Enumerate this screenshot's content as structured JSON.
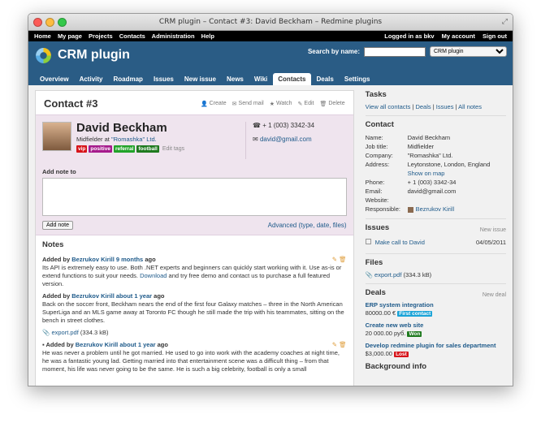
{
  "window": {
    "title": "CRM plugin – Contact #3: David Beckham – Redmine plugins"
  },
  "topmenu": {
    "left": [
      "Home",
      "My page",
      "Projects",
      "Contacts",
      "Administration",
      "Help"
    ],
    "logged_in": "Logged in as bkv",
    "my_account": "My account",
    "sign_out": "Sign out"
  },
  "header": {
    "brand": "CRM plugin",
    "search_label": "Search by name:",
    "project_select": "CRM plugin",
    "tabs": [
      "Overview",
      "Activity",
      "Roadmap",
      "Issues",
      "New issue",
      "News",
      "Wiki",
      "Contacts",
      "Deals",
      "Settings"
    ],
    "active_tab": "Contacts"
  },
  "contact": {
    "title": "Contact #3",
    "actions": [
      "Create",
      "Send mail",
      "Watch",
      "Edit",
      "Delete"
    ],
    "name": "David Beckham",
    "job_prefix": "Midfielder at",
    "company": "\"Romashka\" Ltd.",
    "tags": [
      {
        "label": "vip",
        "color": "#d7141a"
      },
      {
        "label": "positive",
        "color": "#a61b8c"
      },
      {
        "label": "referral",
        "color": "#22a32a"
      },
      {
        "label": "football",
        "color": "#1f7a1f"
      }
    ],
    "edit_tags": "Edit tags",
    "phone": "+ 1 (003) 3342-34",
    "email": "david@gmail.com"
  },
  "note_form": {
    "label": "Add note to",
    "button": "Add note",
    "advanced": "Advanced (type, date, files)"
  },
  "notes": {
    "title": "Notes",
    "items": [
      {
        "added_by": "Added by",
        "author": "Bezrukov Kirill",
        "time": "9 months",
        "ago": "ago",
        "text_pre": "Its API is extremely easy to use. Both .NET experts and beginners can quickly start working with it. Use as-is or extend functions to suit your needs.",
        "link": "Download",
        "text_post": "and try free demo and contact us to purchase a full featured version."
      },
      {
        "added_by": "Added by",
        "author": "Bezrukov Kirill",
        "time": "about 1 year",
        "ago": "ago",
        "text": "Back on the soccer front, Beckham nears the end of the first four Galaxy matches – three in the North American SuperLiga and an MLS game away at Toronto FC though he still made the trip with his teammates, sitting on the bench in street clothes.",
        "attachment": "export.pdf",
        "attachment_size": "(334.3 kB)"
      },
      {
        "added_by": "Added by",
        "author": "Bezrukov Kirill",
        "time": "about 1 year",
        "ago": "ago",
        "text": "He was never a problem until he got married. He used to go into work with the academy coaches at night time, he was a fantastic young lad. Getting married into that entertainment scene was a difficult thing – from that moment, his life was never going to be the same. He is such a big celebrity, football is only a small"
      }
    ]
  },
  "sidebar": {
    "tasks_title": "Tasks",
    "tasks_links": [
      "View all contacts",
      "Deals",
      "Issues",
      "All notes"
    ],
    "contact_title": "Contact",
    "details": [
      {
        "k": "Name:",
        "v": "David Beckham"
      },
      {
        "k": "Job title:",
        "v": "Midfielder"
      },
      {
        "k": "Company:",
        "v": "\"Romashka\" Ltd."
      },
      {
        "k": "Address:",
        "v": "Leytonstone, London, England",
        "link": "Show on map"
      },
      {
        "k": "Phone:",
        "v": "+ 1 (003) 3342-34"
      },
      {
        "k": "Email:",
        "v": "david@gmail.com"
      },
      {
        "k": "Website:",
        "v": ""
      },
      {
        "k": "Responsible:",
        "v": "Bezrukov Kirill"
      }
    ],
    "issues_title": "Issues",
    "new_issue": "New issue",
    "issue": {
      "label": "Make call to David",
      "date": "04/05/2011"
    },
    "files_title": "Files",
    "file": {
      "name": "export.pdf",
      "size": "(334.3 kB)"
    },
    "deals_title": "Deals",
    "new_deal": "New deal",
    "deals": [
      {
        "name": "ERP system integration",
        "amount": "80000.00 €",
        "status": "First contact",
        "color": "#1aa3d7"
      },
      {
        "name": "Create new web site",
        "amount": "20 000.00 руб.",
        "status": "Won",
        "color": "#1f7a1f"
      },
      {
        "name": "Develop redmine plugin for sales department",
        "amount": "$3,000.00",
        "status": "Lost",
        "color": "#d7141a"
      }
    ],
    "background_title": "Background info"
  }
}
